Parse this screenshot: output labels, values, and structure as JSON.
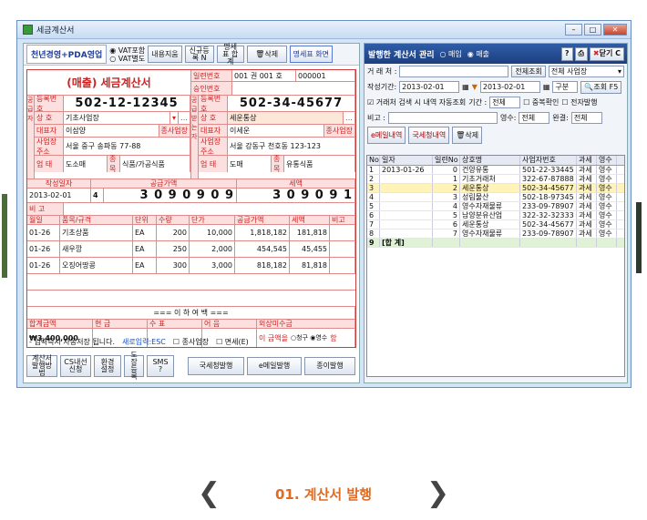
{
  "window": {
    "title": "세금계산서"
  },
  "left": {
    "logo": "천년경영+PDA영업",
    "vat_options": [
      "VAT포함",
      "VAT별도"
    ],
    "buttons": [
      "내용지움",
      "신규등록 N",
      "명세표 합계",
      "삭제",
      "명세표 화면"
    ],
    "title": "(매출) 세금계산서",
    "serial_label": "일련번호",
    "book_label": "001 권 001 호",
    "serial_value": "000001",
    "approval_label": "승인번호",
    "supplier": {
      "reg_label": "등록번호",
      "reg_no": "502-12-12345",
      "name_label": "상 호",
      "name": "기초사업장",
      "ceo_label": "대표자",
      "ceo": "이삼양",
      "addr_label": "사업장 주소",
      "addr": "서울 중구 송파동 77-88",
      "biz_label": "업 태",
      "biz": "도소매",
      "type_label": "종 목",
      "type": "식품/가공식품",
      "id_label": "종사업장"
    },
    "buyer": {
      "reg_no": "502-34-45677",
      "name": "세운통상",
      "ceo": "이세운",
      "addr": "서울 강동구 천호동 123-123",
      "biz": "도매",
      "type": "유통식품"
    },
    "write_label": "작성일자",
    "supply_label": "공급가액",
    "tax_label": "세액",
    "date": "2013-02-01",
    "blank": "4",
    "supply_amount": "3 0 9 0 9 0 9",
    "tax_amount": "3 0 9 0 9 1",
    "note_label": "비 고",
    "item_headers": [
      "월일",
      "품목/규격",
      "단위",
      "수량",
      "단가",
      "공급가액",
      "세액",
      "비고"
    ],
    "items": [
      {
        "date": "01-26",
        "name": "기초상품",
        "unit": "EA",
        "qty": "200",
        "price": "10,000",
        "supply": "1,818,182",
        "tax": "181,818"
      },
      {
        "date": "01-26",
        "name": "새우깡",
        "unit": "EA",
        "qty": "250",
        "price": "2,000",
        "supply": "454,545",
        "tax": "45,455"
      },
      {
        "date": "01-26",
        "name": "오징어땅콩",
        "unit": "EA",
        "qty": "300",
        "price": "3,000",
        "supply": "818,182",
        "tax": "81,818"
      }
    ],
    "end_text": "=== 이 하 여 백 ===",
    "total_headers": [
      "합계금액",
      "현 금",
      "수 표",
      "어 음",
      "외상미수금"
    ],
    "total": "₩3,400,000",
    "receipt_text": "이 금액을",
    "receipt_opts": [
      "청구",
      "영수"
    ],
    "receipt_suffix": "함",
    "autosave": "- 입력즉시 자동저장 됩니다.",
    "new_input": "새로입력:ESC",
    "biz_chk": "종사업장",
    "tax_chk": "면세(E)",
    "bottom_buttons": [
      "계산서 발행방법",
      "CS내선 신청",
      "환경 설정",
      "도장 등록",
      "SMS ?",
      "국세청발행",
      "e메일발행",
      "종이발행"
    ]
  },
  "right": {
    "title": "발행한 계산서 관리",
    "opts": [
      "매입",
      "매출"
    ],
    "close": "닫기 C",
    "client_label": "거 래 처 :",
    "view_all": "전체조회",
    "all_site": "전체 사업장",
    "date_label": "작성기간:",
    "date_from": "2013-02-01",
    "date_to": "2013-02-01",
    "period": "구분",
    "query": "조회 F5",
    "auto_chk": "거래처 검색 시 내역 자동조회",
    "term_label": "기간 :",
    "term_val": "전체",
    "dup_chk": "중복확인",
    "ebill_chk": "전자발행",
    "note_label": "비고 :",
    "receipt_label": "영수:",
    "receipt_val": "전체",
    "done_label": "완결:",
    "done_val": "전체",
    "tabs": [
      "e메일내역",
      "국세청내역",
      "삭제"
    ],
    "grid_headers": [
      "No",
      "일자",
      "일련No",
      "상호명",
      "사업자번호",
      "과세",
      "영수"
    ],
    "rows": [
      [
        "1",
        "2013-01-26",
        "0",
        "건양유통",
        "501-22-33445",
        "과세",
        "영수"
      ],
      [
        "2",
        "",
        "1",
        "기초거래처",
        "322-67-87888",
        "과세",
        "영수"
      ],
      [
        "3",
        "",
        "2",
        "세운통상",
        "502-34-45677",
        "과세",
        "영수"
      ],
      [
        "4",
        "",
        "3",
        "성림물산",
        "502-18-97345",
        "과세",
        "영수"
      ],
      [
        "5",
        "",
        "4",
        "영수자재물류",
        "233-09-78907",
        "과세",
        "영수"
      ],
      [
        "6",
        "",
        "5",
        "남양분유산업",
        "322-32-32333",
        "과세",
        "영수"
      ],
      [
        "7",
        "",
        "6",
        "세운통상",
        "502-34-45677",
        "과세",
        "영수"
      ],
      [
        "8",
        "",
        "7",
        "영수자재물류",
        "233-09-78907",
        "과세",
        "영수"
      ],
      [
        "9",
        "[합 계]",
        "",
        "",
        "",
        "",
        ""
      ]
    ]
  },
  "nav": {
    "label": "01. 계산서 발행"
  },
  "colors": {
    "accent": "#e06b1f",
    "invoice_red": "#d23b3b",
    "header_blue": "#1d3f7f"
  }
}
